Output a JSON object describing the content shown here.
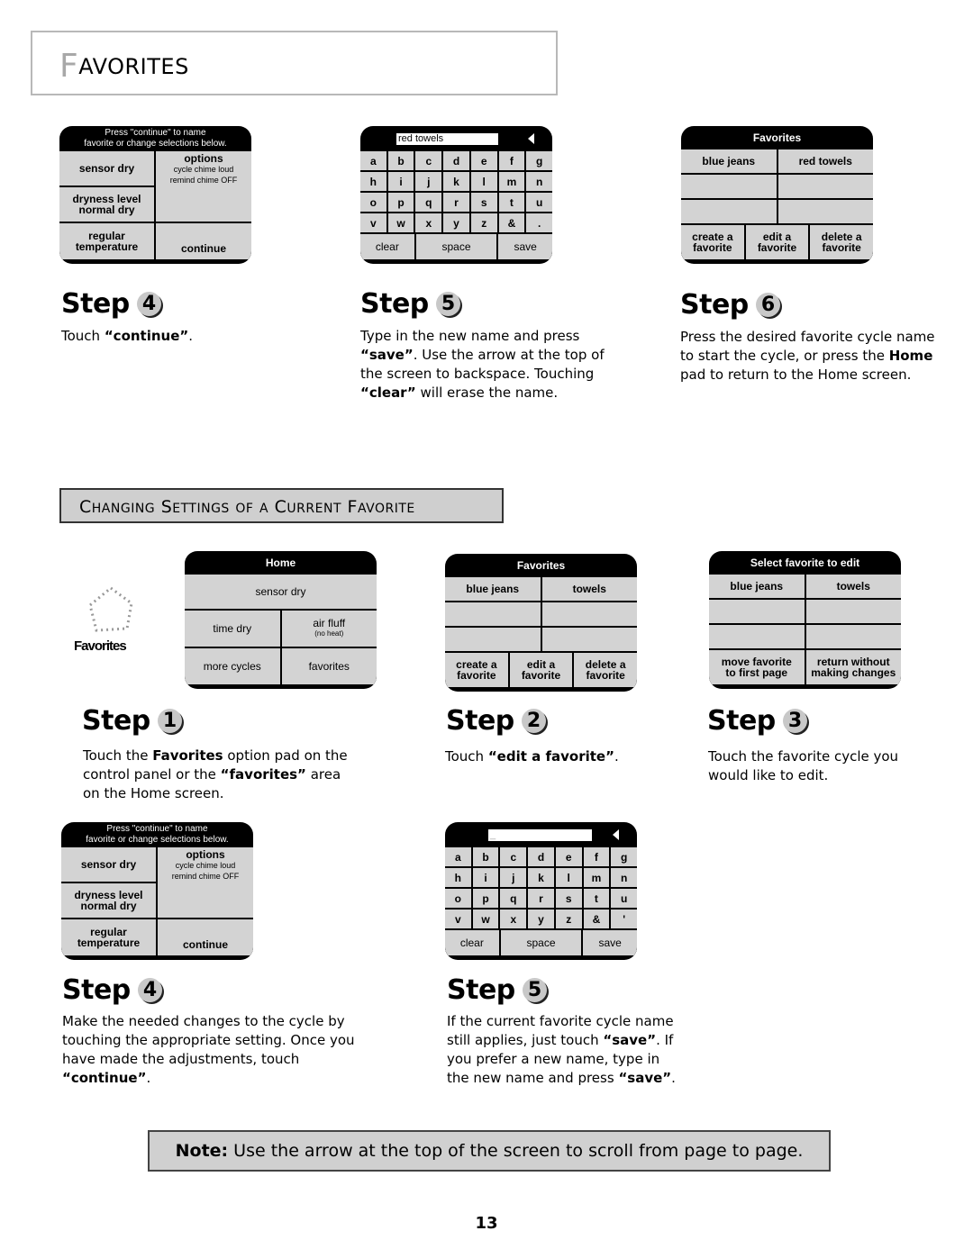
{
  "section": {
    "title_initial": "F",
    "title_rest": "AVORITES"
  },
  "top_row": {
    "screen_continue": {
      "header_line1": "Press \"continue\" to name",
      "header_line2": "favorite or change selections below.",
      "sensor_dry": "sensor dry",
      "dryness_line1": "dryness level",
      "dryness_line2": "normal dry",
      "temp_line1": "regular",
      "temp_line2": "temperature",
      "options_title": "options",
      "options_line1": "cycle chime loud",
      "options_line2": "remind chime OFF",
      "continue": "continue"
    },
    "screen_keyboard": {
      "input_value": "red towels",
      "keys": [
        "a",
        "b",
        "c",
        "d",
        "e",
        "f",
        "g",
        "h",
        "i",
        "j",
        "k",
        "l",
        "m",
        "n",
        "o",
        "p",
        "q",
        "r",
        "s",
        "t",
        "u",
        "v",
        "w",
        "x",
        "y",
        "z",
        "&",
        "."
      ],
      "clear": "clear",
      "space": "space",
      "save": "save"
    },
    "screen_favorites": {
      "title": "Favorites",
      "slots": [
        "blue jeans",
        "red towels",
        "",
        "",
        "",
        ""
      ],
      "create_line1": "create a",
      "create_line2": "favorite",
      "edit_line1": "edit a",
      "edit_line2": "favorite",
      "delete_line1": "delete a",
      "delete_line2": "favorite"
    },
    "steps": [
      {
        "label": "Step",
        "number": "4",
        "text_html": "Touch <b>“continue”</b>."
      },
      {
        "label": "Step",
        "number": "5",
        "text_html": "Type in the new name and press <b>“save”</b>. Use the arrow at the top of the screen to backspace.  Touching <b>“clear”</b> will erase the name."
      },
      {
        "label": "Step",
        "number": "6",
        "text_html": "Press the desired favorite cycle name to start the cycle, or press the <b>Home</b> pad to return to the Home screen."
      }
    ]
  },
  "subsection": {
    "title": "Changing Settings of a Current Favorite"
  },
  "middle_row": {
    "favorites_pad_label": "Favorites",
    "screen_home": {
      "title": "Home",
      "sensor_dry": "sensor dry",
      "time_dry": "time dry",
      "air_fluff": "air fluff",
      "air_fluff_sub": "(no heat)",
      "more_cycles": "more cycles",
      "favorites": "favorites"
    },
    "screen_favorites": {
      "title": "Favorites",
      "slots": [
        "blue jeans",
        "towels",
        "",
        "",
        "",
        ""
      ],
      "create_line1": "create a",
      "create_line2": "favorite",
      "edit_line1": "edit a",
      "edit_line2": "favorite",
      "delete_line1": "delete a",
      "delete_line2": "favorite"
    },
    "screen_select": {
      "title": "Select favorite to edit",
      "slots": [
        "blue jeans",
        "towels",
        "",
        "",
        "",
        ""
      ],
      "move_line1": "move favorite",
      "move_line2": "to first page",
      "return_line1": "return without",
      "return_line2": "making changes"
    },
    "steps": [
      {
        "label": "Step",
        "number": "1",
        "text_html": "Touch the <b>Favorites</b> option pad on the control panel or the <b>“favorites”</b> area on the Home screen."
      },
      {
        "label": "Step",
        "number": "2",
        "text_html": "Touch <b>“edit a favorite”</b>."
      },
      {
        "label": "Step",
        "number": "3",
        "text_html": "Touch the favorite cycle you would like to edit."
      }
    ]
  },
  "bottom_row": {
    "screen_continue": {
      "header_line1": "Press \"continue\" to name",
      "header_line2": "favorite or change selections below.",
      "sensor_dry": "sensor dry",
      "dryness_line1": "dryness level",
      "dryness_line2": "normal dry",
      "temp_line1": "regular",
      "temp_line2": "temperature",
      "options_title": "options",
      "options_line1": "cycle chime loud",
      "options_line2": "remind chime OFF",
      "continue": "continue"
    },
    "screen_keyboard": {
      "input_value": "_",
      "keys": [
        "a",
        "b",
        "c",
        "d",
        "e",
        "f",
        "g",
        "h",
        "i",
        "j",
        "k",
        "l",
        "m",
        "n",
        "o",
        "p",
        "q",
        "r",
        "s",
        "t",
        "u",
        "v",
        "w",
        "x",
        "y",
        "z",
        "&",
        "'"
      ],
      "clear": "clear",
      "space": "space",
      "save": "save"
    },
    "steps": [
      {
        "label": "Step",
        "number": "4",
        "text_html": "Make the needed changes to the cycle by touching the appropriate setting.  Once you have made the adjustments,  touch <b>“continue”</b>."
      },
      {
        "label": "Step",
        "number": "5",
        "text_html": "If the current favorite cycle name still applies, just touch <b>“save”</b>.  If you prefer a new name, type in the new name and press <b>“save”</b>."
      }
    ]
  },
  "note": {
    "label": "Note:",
    "text": " Use the arrow at the top of the screen to scroll from page to page."
  },
  "page_number": "13"
}
